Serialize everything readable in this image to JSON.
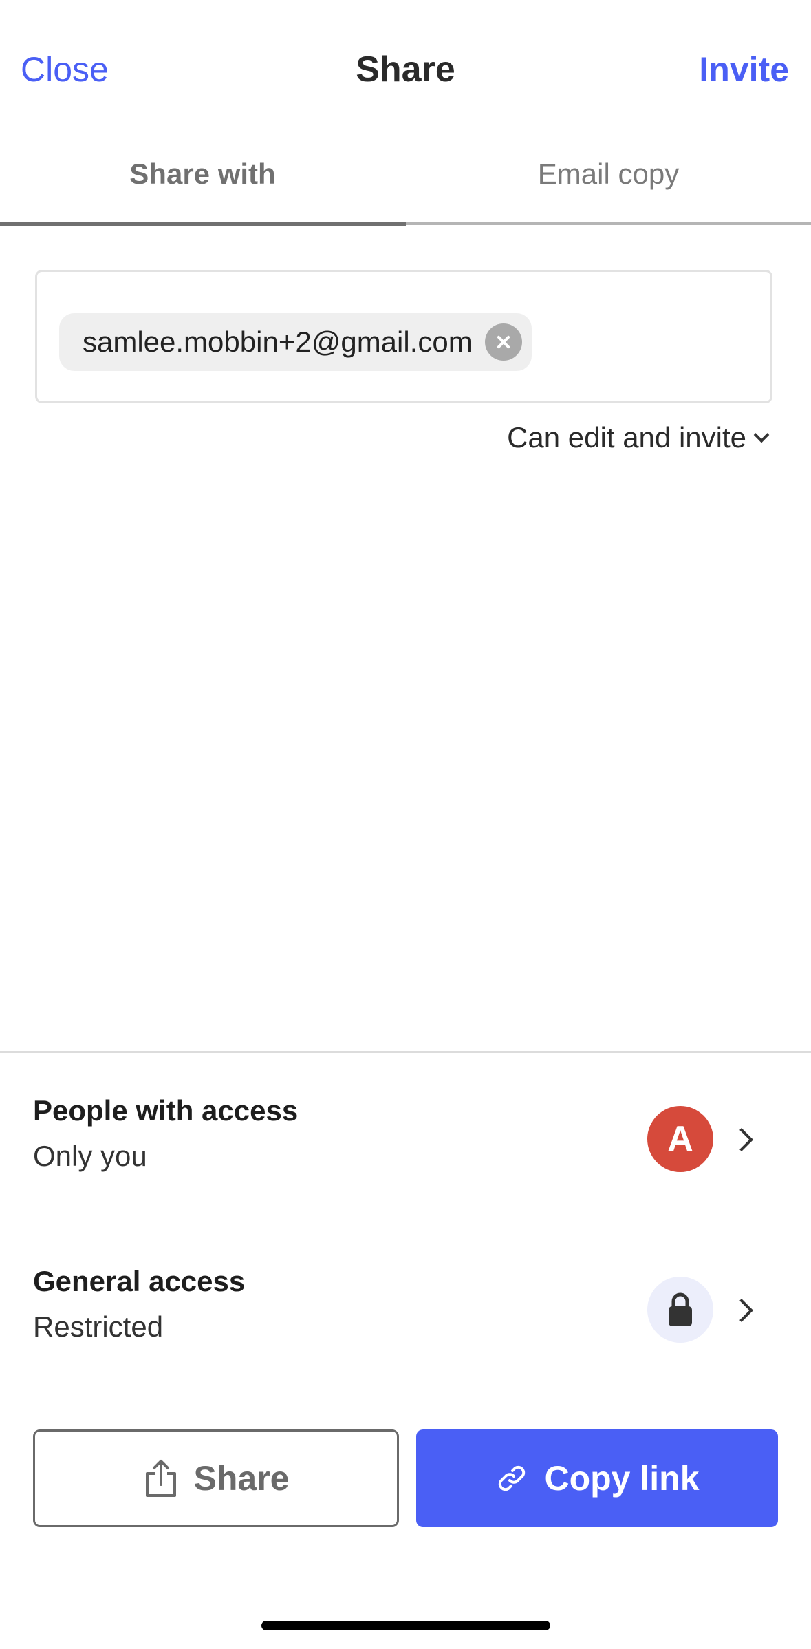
{
  "header": {
    "close_label": "Close",
    "title": "Share",
    "invite_label": "Invite"
  },
  "tabs": [
    {
      "label": "Share with",
      "active": true
    },
    {
      "label": "Email copy",
      "active": false
    }
  ],
  "recipients": {
    "chips": [
      {
        "email": "samlee.mobbin+2@gmail.com"
      }
    ],
    "permission": "Can edit and invite"
  },
  "access": {
    "people": {
      "title": "People with access",
      "subtitle": "Only you",
      "avatar_letter": "A",
      "avatar_color": "#d64a3b"
    },
    "general": {
      "title": "General access",
      "subtitle": "Restricted",
      "icon": "lock-icon"
    }
  },
  "actions": {
    "share_label": "Share",
    "share_icon": "share-icon",
    "copy_link_label": "Copy link",
    "copy_link_icon": "link-icon"
  },
  "colors": {
    "accent": "#4a5ff5",
    "avatar": "#d64a3b"
  }
}
